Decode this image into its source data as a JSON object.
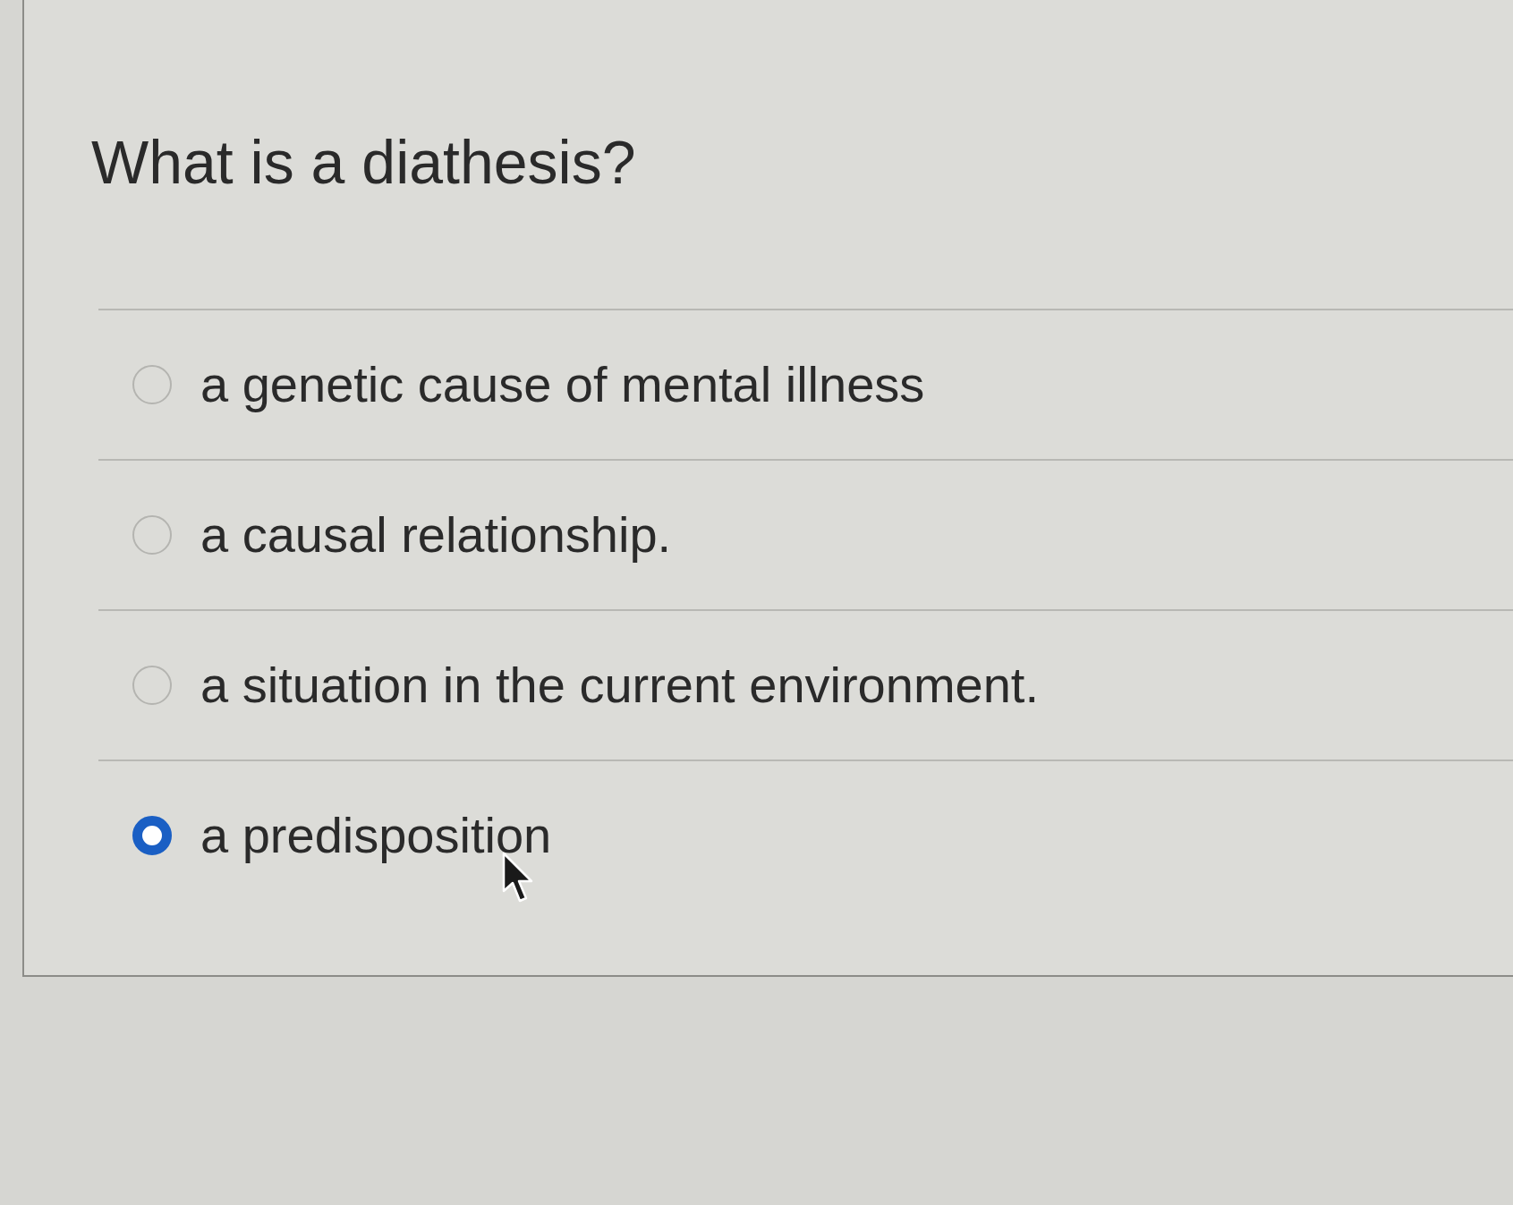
{
  "question": {
    "title": "What is a diathesis?"
  },
  "options": [
    {
      "label": "a genetic cause of mental illness",
      "selected": false
    },
    {
      "label": "a causal relationship.",
      "selected": false
    },
    {
      "label": "a situation in the current environment.",
      "selected": false
    },
    {
      "label": "a predisposition",
      "selected": true
    }
  ]
}
